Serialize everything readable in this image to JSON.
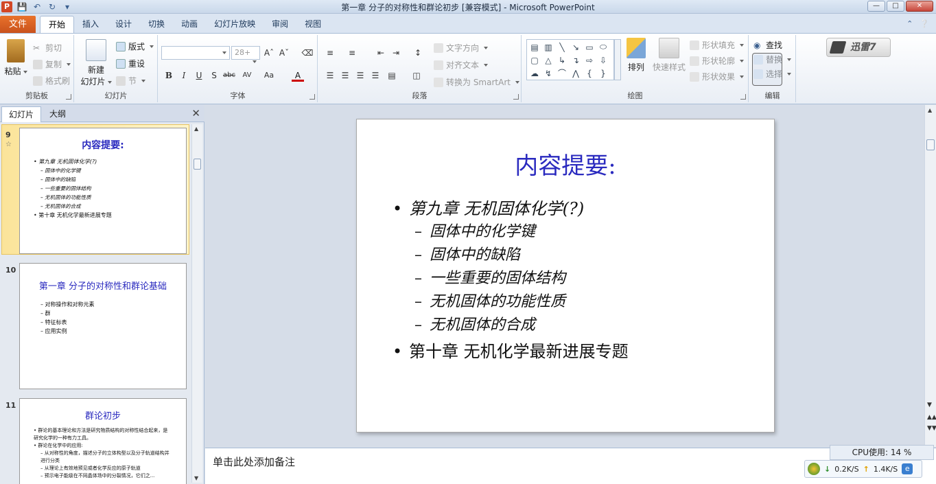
{
  "window": {
    "title": "第一章  分子的对称性和群论初步 [兼容模式]  -  Microsoft PowerPoint",
    "app_icon_letter": "P"
  },
  "ribbon_tabs": {
    "file": "文件",
    "items": [
      "开始",
      "插入",
      "设计",
      "切换",
      "动画",
      "幻灯片放映",
      "审阅",
      "视图"
    ],
    "active": "开始"
  },
  "clipboard": {
    "paste": "粘贴",
    "cut": "剪切",
    "copy": "复制",
    "format_painter": "格式刷",
    "label": "剪贴板"
  },
  "slides_group": {
    "new_slide_line1": "新建",
    "new_slide_line2": "幻灯片",
    "layout": "版式",
    "reset": "重设",
    "section": "节",
    "label": "幻灯片"
  },
  "font_group": {
    "font_name": "",
    "font_size": "28+",
    "label": "字体"
  },
  "paragraph_group": {
    "text_direction": "文字方向",
    "align_text": "对齐文本",
    "convert_smartart": "转换为 SmartArt",
    "label": "段落"
  },
  "drawing_group": {
    "arrange": "排列",
    "quick_styles": "快速样式",
    "shape_fill": "形状填充",
    "shape_outline": "形状轮廓",
    "shape_effects": "形状效果",
    "label": "绘图"
  },
  "editing_group": {
    "find": "查找",
    "replace": "替换",
    "select": "选择",
    "label": "编辑"
  },
  "xunlei": {
    "label": "迅雷7"
  },
  "left_panel": {
    "tab_slides": "幻灯片",
    "tab_outline": "大纲"
  },
  "thumbnails": [
    {
      "number": "9",
      "title": "内容提要:",
      "lines": [
        {
          "level": 1,
          "text": "第九章 无机固体化学(?)",
          "italic": true
        },
        {
          "level": 2,
          "text": "固体中的化学键"
        },
        {
          "level": 2,
          "text": "固体中的缺陷"
        },
        {
          "level": 2,
          "text": "一些重要的固体结构"
        },
        {
          "level": 2,
          "text": "无机固体的功能性质"
        },
        {
          "level": 2,
          "text": "无机固体的合成"
        },
        {
          "level": 1,
          "text": "第十章 无机化学最新进展专题",
          "italic": false
        }
      ]
    },
    {
      "number": "10",
      "title": "第一章  分子的对称性和群论基础",
      "lines": [
        {
          "level": 2,
          "text": "对称操作和对称元素"
        },
        {
          "level": 2,
          "text": "群"
        },
        {
          "level": 2,
          "text": "特征标表"
        },
        {
          "level": 2,
          "text": "应用实例"
        }
      ]
    },
    {
      "number": "11",
      "title": "群论初步",
      "lines": [
        {
          "level": 1,
          "text": "群论的基本理论和方法是研究物质结构的对称性结合起来，是研究化学的一种有力工具。"
        },
        {
          "level": 1,
          "text": "群论在化学中的应用:"
        },
        {
          "level": 2,
          "text": "从对称性的角度，描述分子的立体构型以及分子轨道结构并进行分类"
        },
        {
          "level": 2,
          "text": "从理论上有效地预见或者化学反应的原子轨道"
        },
        {
          "level": 2,
          "text": "预示电子能级在不同晶体场中的分裂情况，它们之..."
        }
      ]
    }
  ],
  "slide": {
    "title": "内容提要:",
    "bullets": [
      {
        "text": "第九章 无机固体化学(?)",
        "italic": true,
        "subs": [
          "固体中的化学键",
          "固体中的缺陷",
          "一些重要的固体结构",
          "无机固体的功能性质",
          "无机固体的合成"
        ]
      },
      {
        "text": "第十章 无机化学最新进展专题",
        "italic": false,
        "subs": []
      }
    ]
  },
  "notes": {
    "placeholder": "单击此处添加备注"
  },
  "monitor": {
    "cpu": "CPU使用: 14 %",
    "download": "0.2K/S",
    "upload": "1.4K/S"
  }
}
